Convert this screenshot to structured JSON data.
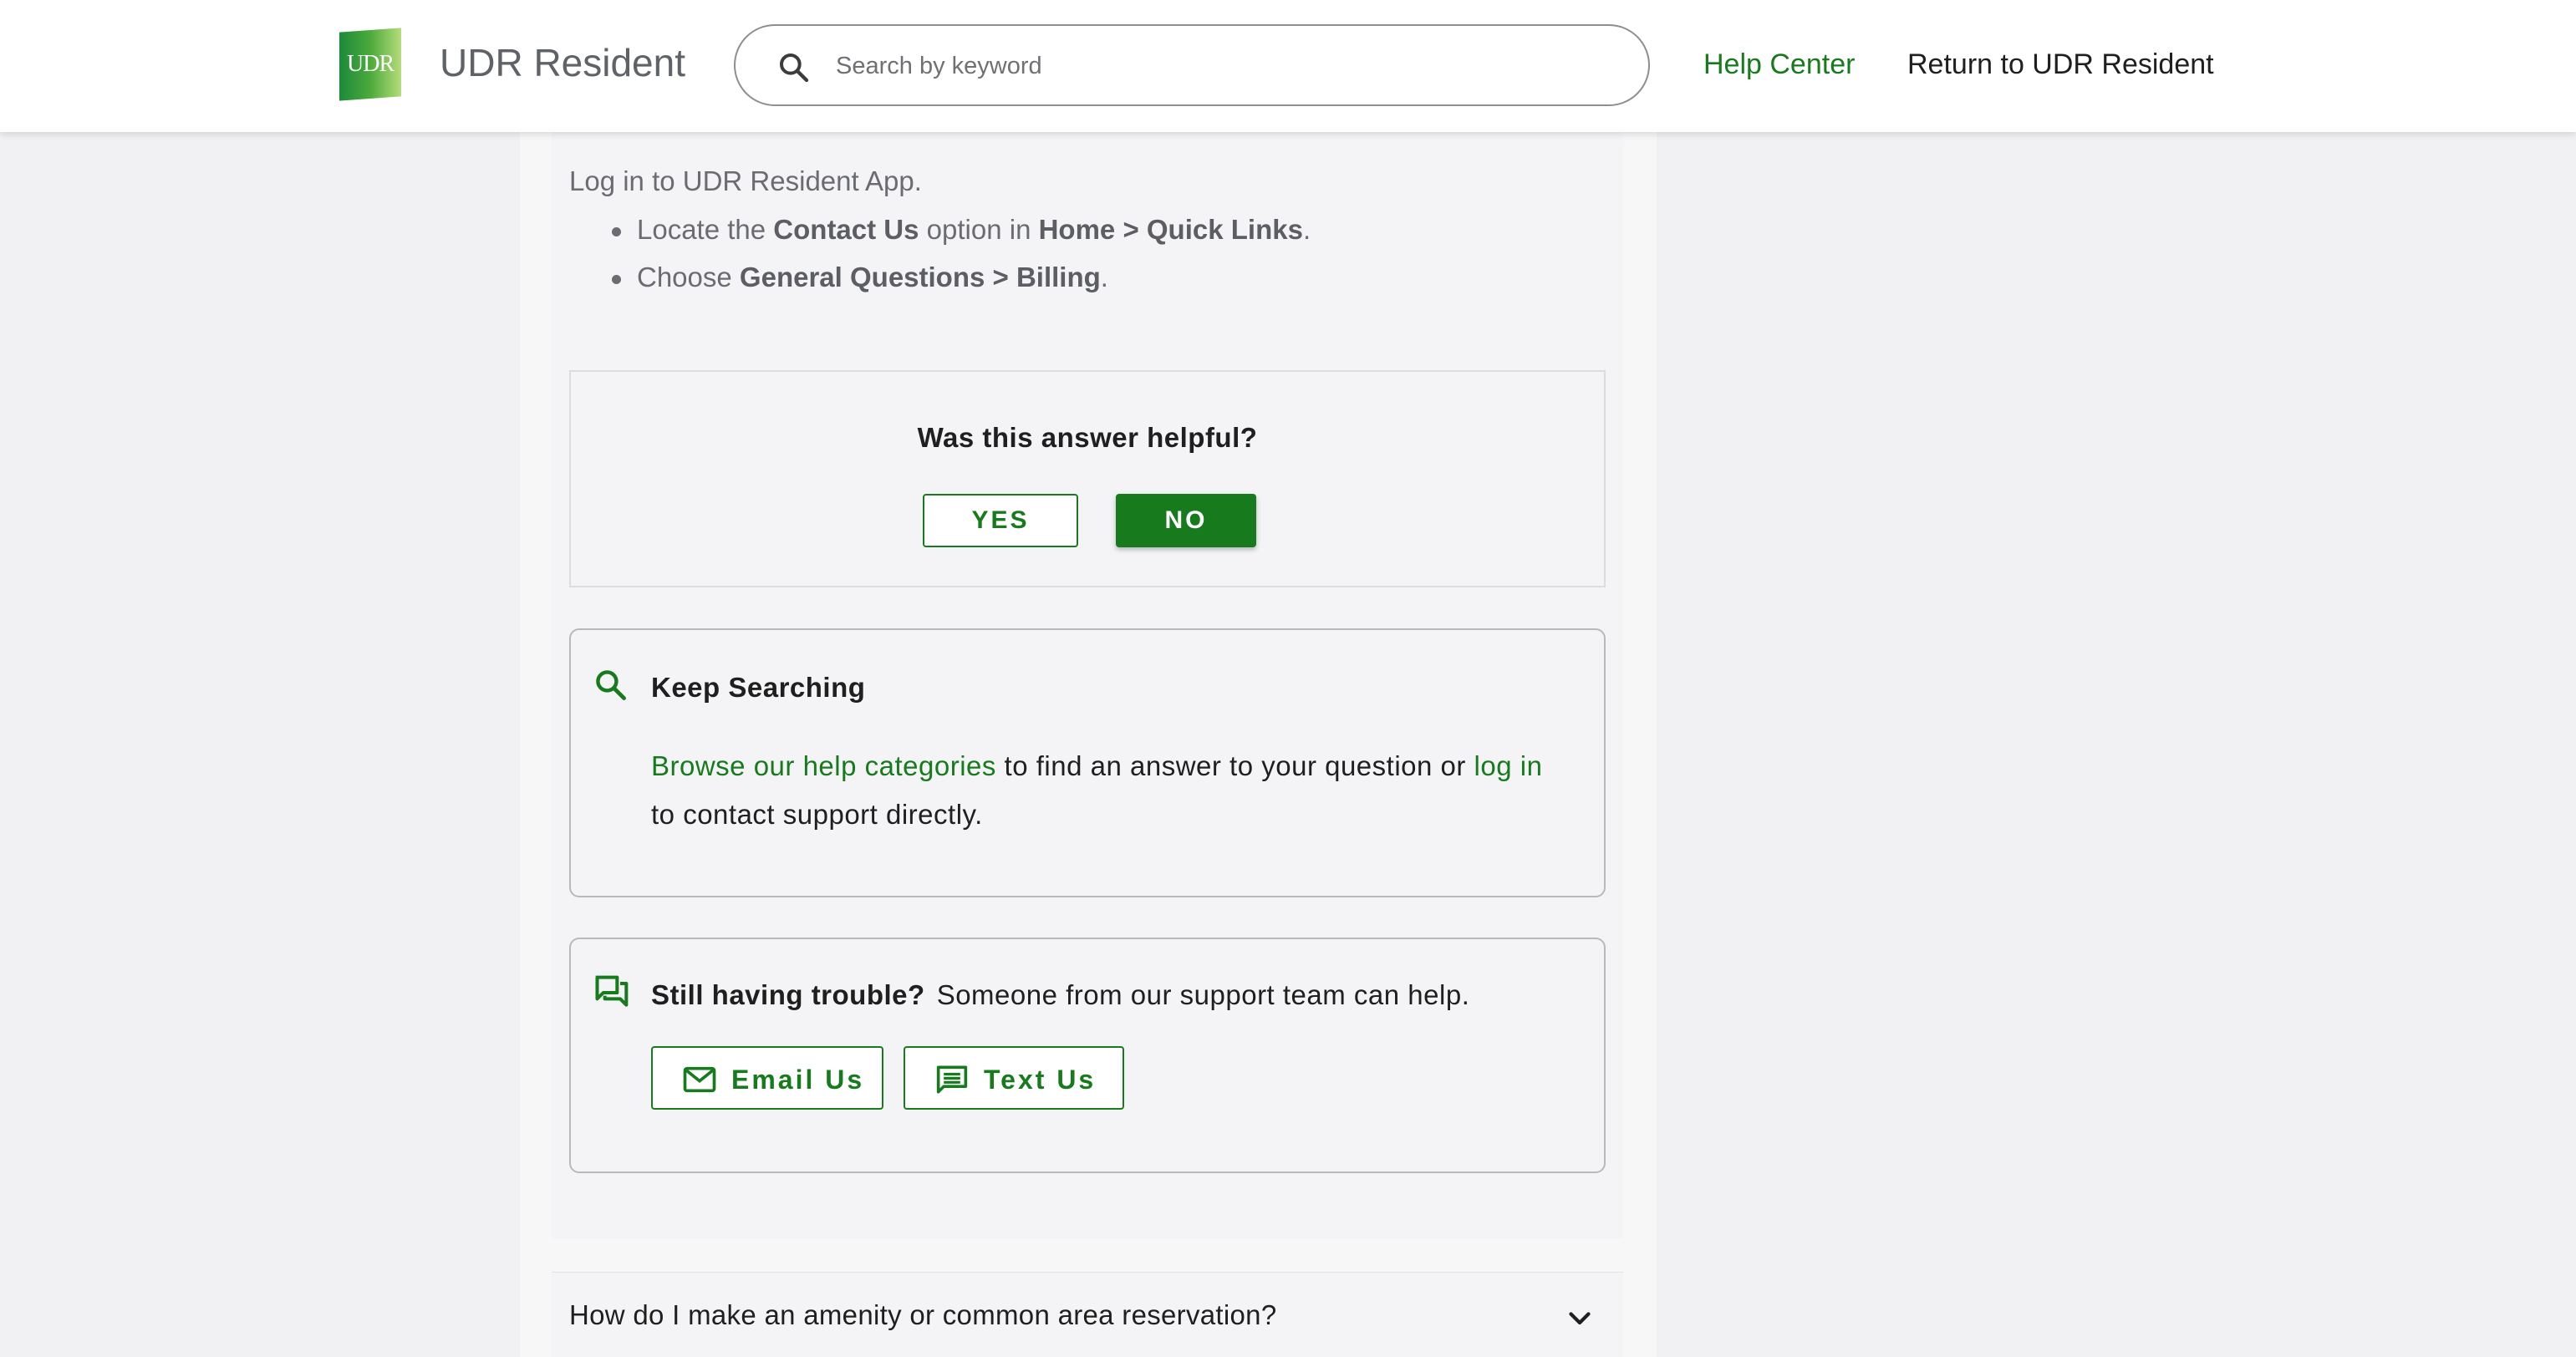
{
  "header": {
    "logo_text": "UDR",
    "brand": "UDR Resident",
    "search_placeholder": "Search by keyword",
    "nav": {
      "help_center": "Help Center",
      "return": "Return to UDR Resident"
    }
  },
  "article": {
    "intro": "Log in to UDR Resident App.",
    "steps": [
      {
        "pre": "Locate the ",
        "b1": "Contact Us",
        "mid": " option in ",
        "b2": "Home > Quick Links",
        "post": "."
      },
      {
        "pre": "Choose ",
        "b1": "General Questions > Billing",
        "post": "."
      }
    ]
  },
  "feedback": {
    "question": "Was this answer helpful?",
    "yes": "YES",
    "no": "NO"
  },
  "keep_searching": {
    "title": "Keep Searching",
    "link1": "Browse our help categories",
    "mid": " to find an answer to your question or ",
    "link2": "log in",
    "post": " to contact support directly."
  },
  "trouble": {
    "title": "Still having trouble?",
    "text": "Someone from our support team can help.",
    "email": "Email Us",
    "sms": "Text Us"
  },
  "accordion": {
    "question": "How do I make an amenity or common area reservation?"
  },
  "colors": {
    "accent": "#177a1d",
    "background": "#f1f1f3",
    "panel": "#f4f4f6"
  }
}
